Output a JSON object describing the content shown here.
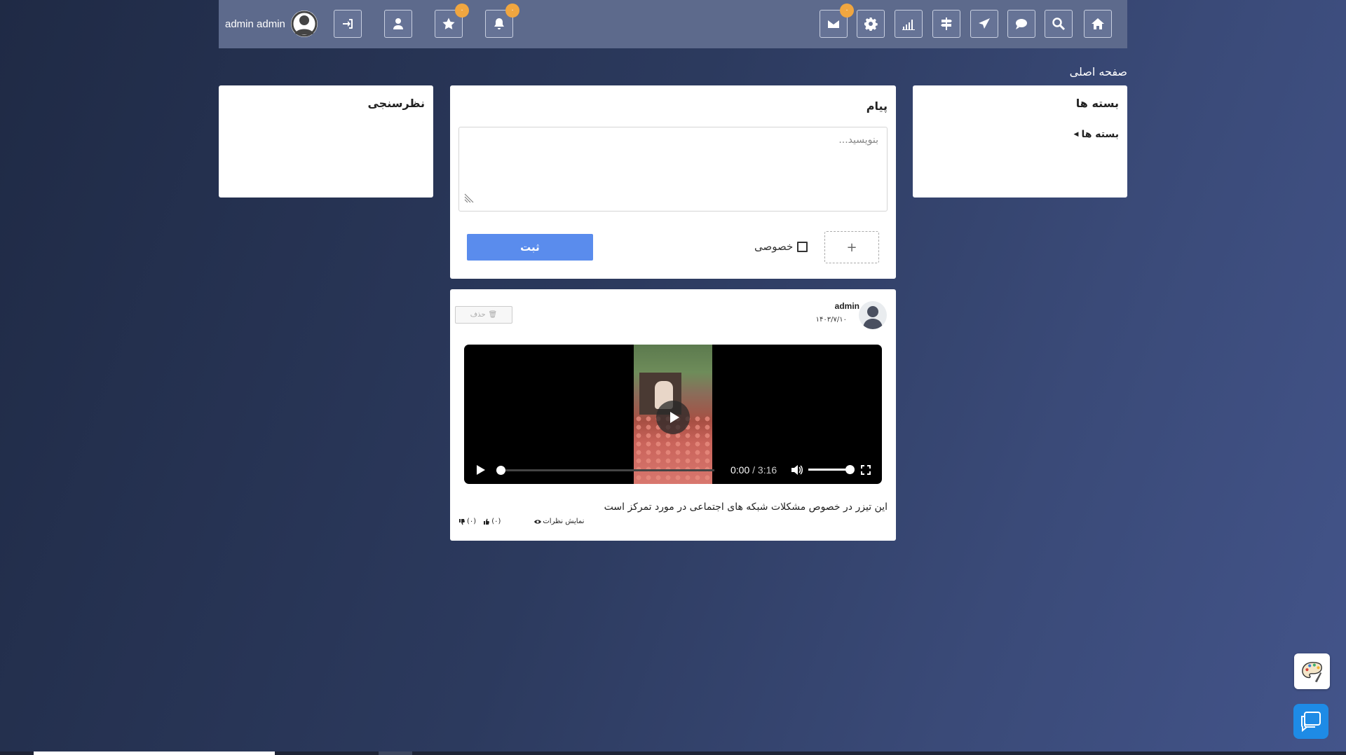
{
  "header": {
    "user_name": "admin admin",
    "notification_badge": "۰",
    "favorites_badge": "۰",
    "messages_badge": "۰",
    "icons": [
      "home-icon",
      "search-icon",
      "chat-icon",
      "send-icon",
      "signpost-icon",
      "stats-icon",
      "gear-icon",
      "envelope-icon",
      "bell-icon",
      "star-icon",
      "user-icon",
      "login-icon"
    ]
  },
  "breadcrumb": "صفحه اصلی",
  "packages": {
    "title": "بسته ها",
    "link_label": "بسته ها"
  },
  "message": {
    "title": "پیام",
    "placeholder": "بنویسید...",
    "attach_label": "+",
    "private_label": "خصوصی",
    "submit_label": "ثبت"
  },
  "poll": {
    "title": "نظرسنجی"
  },
  "post": {
    "author": "admin",
    "date": "۱۴۰۳/۷/۱۰",
    "delete_label": "حذف",
    "video": {
      "current_time": "0:00",
      "duration": "3:16",
      "volume": 1.0,
      "progress": 0.0
    },
    "text": "این تیزر در خصوص مشکلات شبکه های اجتماعی در مورد تمرکز است",
    "show_comments_label": "نمایش نظرات",
    "likes": "(۰)",
    "dislikes": "(۰)"
  },
  "colors": {
    "topbar": "#5d6a8c",
    "badge": "#f0a640",
    "submit": "#5a8ced",
    "chat_fab": "#1e8be6"
  }
}
